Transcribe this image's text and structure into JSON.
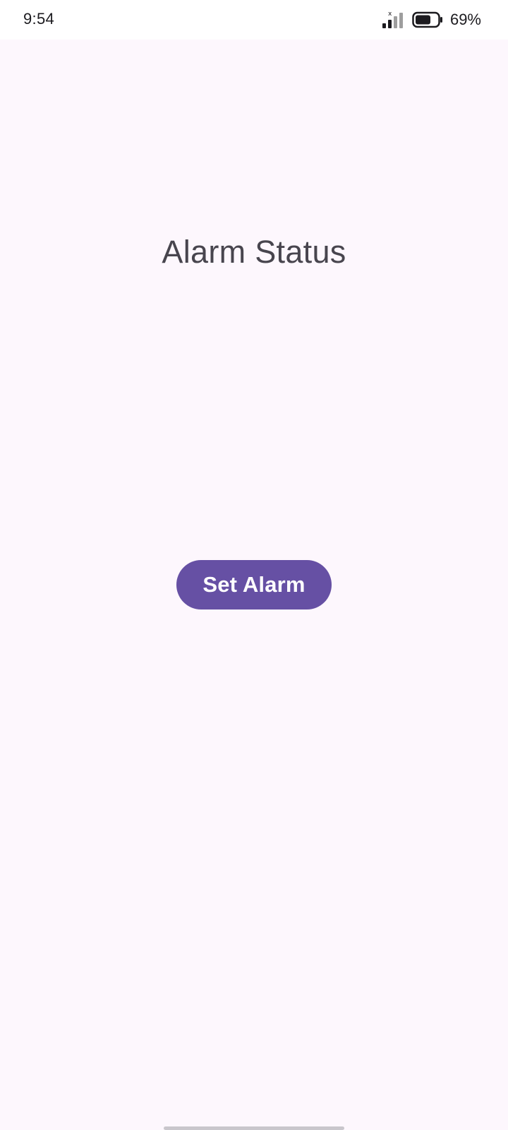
{
  "status_bar": {
    "time": "9:54",
    "battery_percent": "69%",
    "signal_icon": "cellular-signal-icon",
    "battery_icon": "battery-icon"
  },
  "main": {
    "title": "Alarm Status",
    "set_alarm_label": "Set Alarm"
  },
  "colors": {
    "background": "#fdf7fd",
    "button": "#6650a4",
    "title_text": "#48454e"
  }
}
